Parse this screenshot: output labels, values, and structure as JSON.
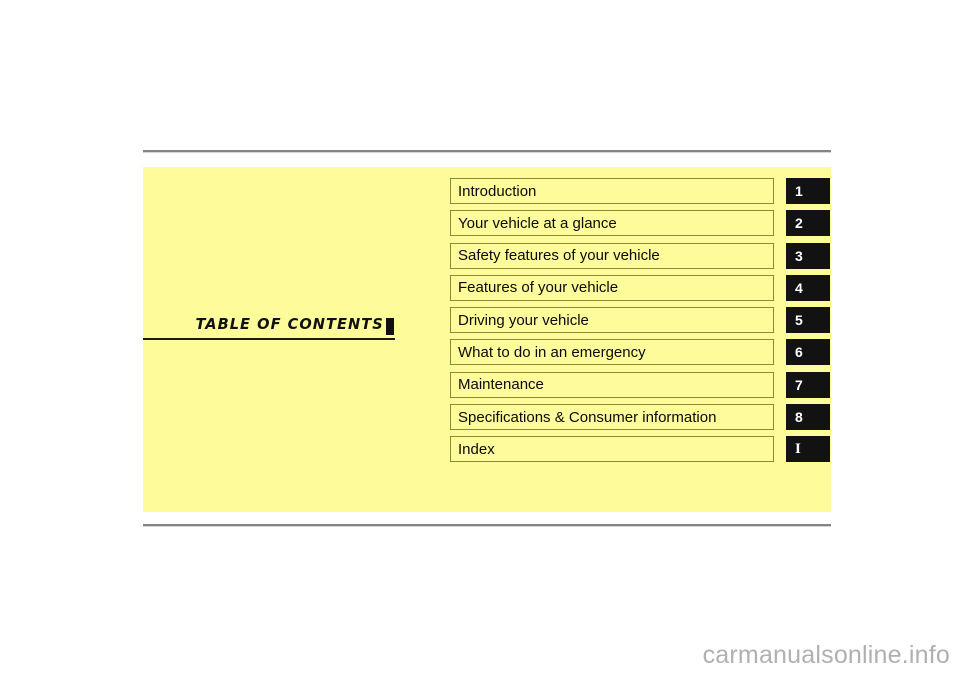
{
  "page": {
    "heading": "TABLE OF CONTENTS",
    "panel_color": "#fdfb9a",
    "rule_color": "#848484",
    "badge_color": "#121212",
    "box_border_color": "#8a8a33"
  },
  "contents": [
    {
      "label": "Introduction",
      "badge": "1"
    },
    {
      "label": "Your vehicle at a glance",
      "badge": "2"
    },
    {
      "label": "Safety features of your vehicle",
      "badge": "3"
    },
    {
      "label": "Features of your vehicle",
      "badge": "4"
    },
    {
      "label": "Driving your vehicle",
      "badge": "5"
    },
    {
      "label": "What to do in an emergency",
      "badge": "6"
    },
    {
      "label": "Maintenance",
      "badge": "7"
    },
    {
      "label": "Specifications & Consumer information",
      "badge": "8"
    },
    {
      "label": "Index",
      "badge": "I"
    }
  ],
  "watermark": "carmanualsonline.info"
}
